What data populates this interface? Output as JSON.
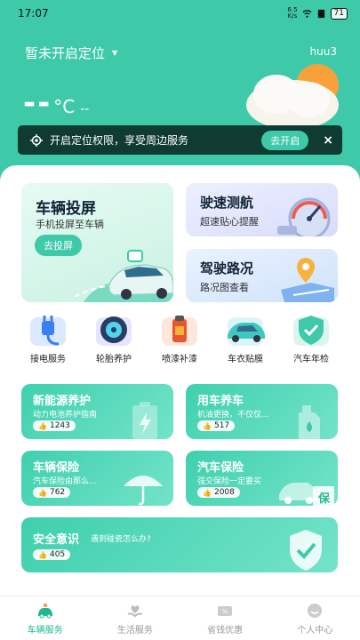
{
  "status_bar": {
    "time": "17:07",
    "net_speed_top": "6.5",
    "net_speed_bottom": "K/s",
    "battery": "71"
  },
  "header": {
    "location_label": "暂未开启定位",
    "username": "huu3",
    "temperature": "--",
    "temperature_unit": "°C",
    "weather_desc": "--"
  },
  "location_banner": {
    "text": "开启定位权限，享受周边服务",
    "button": "去开启",
    "close": "×"
  },
  "feature_cards": {
    "screen_cast": {
      "title": "车辆投屏",
      "subtitle": "手机投屏至车辆",
      "button": "去投屏"
    },
    "speed_nav": {
      "title": "驶速测航",
      "subtitle": "超速贴心提醒"
    },
    "road_status": {
      "title": "驾驶路况",
      "subtitle": "路况图查看"
    }
  },
  "services": [
    {
      "label": "接电服务",
      "icon": "plug-icon"
    },
    {
      "label": "轮胎养护",
      "icon": "tire-icon"
    },
    {
      "label": "喷漆补漆",
      "icon": "paint-can-icon"
    },
    {
      "label": "车衣贴膜",
      "icon": "car-wrap-icon"
    },
    {
      "label": "汽车年检",
      "icon": "shield-check-icon"
    }
  ],
  "info_cards": {
    "nev": {
      "title": "新能源养护",
      "subtitle": "动力电池养护指南",
      "count": "1243"
    },
    "car_care": {
      "title": "用车养车",
      "subtitle": "机油更换，不仅仅...",
      "count": "517"
    },
    "insurance": {
      "title": "车辆保险",
      "subtitle": "汽车保险由那么...",
      "count": "762"
    },
    "auto_insurance": {
      "title": "汽车保险",
      "subtitle": "强交保险一定要买",
      "count": "2008",
      "stamp": "保"
    },
    "safety": {
      "title": "安全意识",
      "subtitle": "遇到碰瓷怎么办?",
      "count": "405"
    }
  },
  "tabbar": [
    {
      "label": "车辆服务",
      "active": true
    },
    {
      "label": "生活服务",
      "active": false
    },
    {
      "label": "省钱优惠",
      "active": false
    },
    {
      "label": "个人中心",
      "active": false
    }
  ],
  "colors": {
    "accent": "#3ec9a8",
    "active_tab": "#1fb892",
    "banner_bg": "#0f3b33"
  }
}
